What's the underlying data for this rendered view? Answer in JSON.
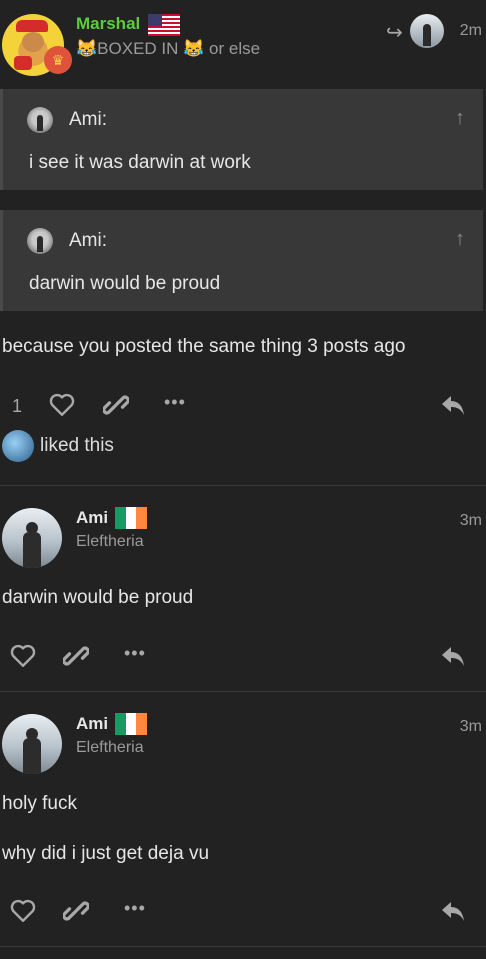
{
  "first_post": {
    "username": "Marshal",
    "user_title": "😹BOXED IN 😹 or else",
    "reply_arrow": "↪",
    "time": "2m",
    "quotes": [
      {
        "author": "Ami:",
        "text": "i see it was darwin at work"
      },
      {
        "author": "Ami:",
        "text": "darwin would be proud"
      }
    ],
    "body": "because you posted the same thing 3 posts ago",
    "like_count": "1",
    "liked_text": "liked this"
  },
  "posts": [
    {
      "username": "Ami",
      "user_title": "Eleftheria",
      "time": "3m",
      "lines": [
        "darwin would be proud"
      ]
    },
    {
      "username": "Ami",
      "user_title": "Eleftheria",
      "time": "3m",
      "lines": [
        "holy fuck",
        "why did i just get deja vu"
      ]
    }
  ],
  "colors": {
    "background": "#222222",
    "quote_bg": "#383838",
    "username_green": "#5ecb3f",
    "irish_green": "#169b62",
    "irish_white": "#ffffff",
    "irish_orange": "#ff883e"
  },
  "icons": [
    "heart-icon",
    "link-icon",
    "more-icon",
    "reply-icon",
    "up-arrow-icon",
    "share-arrow-icon"
  ]
}
